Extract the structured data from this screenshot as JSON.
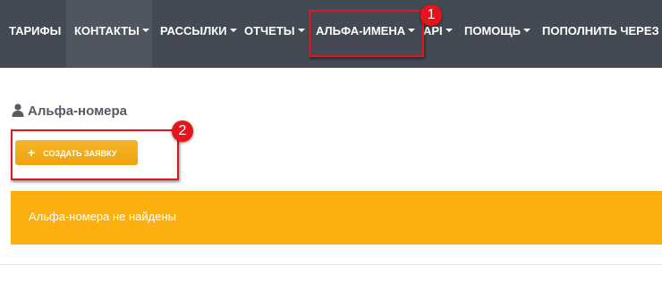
{
  "nav": {
    "tariffs": "ТАРИФЫ",
    "contacts": "КОНТАКТЫ",
    "mailings": "РАССЫЛКИ",
    "reports": "ОТЧЕТЫ",
    "alpha_names": "АЛЬФА-ИМЕНА",
    "api": "API",
    "help": "ПОМОЩЬ",
    "topup": "ПОПОЛНИТЬ ЧЕРЕЗ В"
  },
  "annotations": {
    "step1": "1",
    "step2": "2",
    "color": "#e8141b"
  },
  "page": {
    "title": "Альфа-номера",
    "title_icon": "user-icon",
    "create_button": "СОЗДАТЬ ЗАЯВКУ",
    "create_icon": "plus-icon",
    "empty_message": "Альфа-номера не найдены"
  },
  "colors": {
    "navbar": "#434a54",
    "accent": "#fcb00f",
    "button": "#f0a20c"
  }
}
